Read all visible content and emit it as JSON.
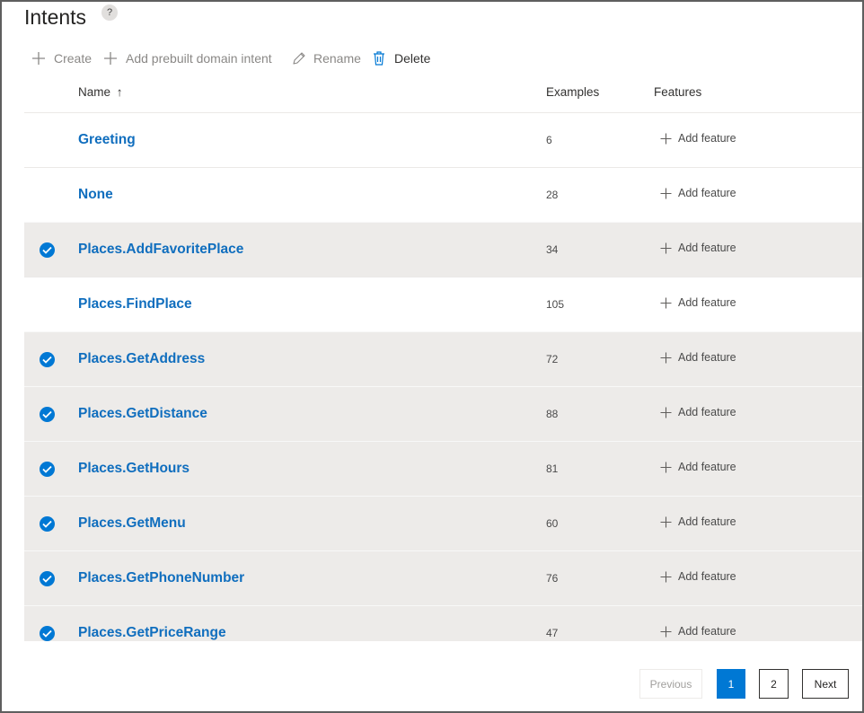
{
  "page": {
    "title": "Intents",
    "help_label": "?"
  },
  "toolbar": {
    "create": "Create",
    "add_prebuilt": "Add prebuilt domain intent",
    "rename": "Rename",
    "delete": "Delete"
  },
  "columns": {
    "name": "Name",
    "sort_indicator": "↑",
    "examples": "Examples",
    "features": "Features"
  },
  "rows": [
    {
      "name": "Greeting",
      "examples": "6",
      "feature": "Add feature",
      "selected": false
    },
    {
      "name": "None",
      "examples": "28",
      "feature": "Add feature",
      "selected": false
    },
    {
      "name": "Places.AddFavoritePlace",
      "examples": "34",
      "feature": "Add feature",
      "selected": true
    },
    {
      "name": "Places.FindPlace",
      "examples": "105",
      "feature": "Add feature",
      "selected": false
    },
    {
      "name": "Places.GetAddress",
      "examples": "72",
      "feature": "Add feature",
      "selected": true
    },
    {
      "name": "Places.GetDistance",
      "examples": "88",
      "feature": "Add feature",
      "selected": true
    },
    {
      "name": "Places.GetHours",
      "examples": "81",
      "feature": "Add feature",
      "selected": true
    },
    {
      "name": "Places.GetMenu",
      "examples": "60",
      "feature": "Add feature",
      "selected": true
    },
    {
      "name": "Places.GetPhoneNumber",
      "examples": "76",
      "feature": "Add feature",
      "selected": true
    },
    {
      "name": "Places.GetPriceRange",
      "examples": "47",
      "feature": "Add feature",
      "selected": true
    }
  ],
  "pagination": {
    "previous": "Previous",
    "pages": [
      "1",
      "2"
    ],
    "current_page": "1",
    "next": "Next"
  },
  "colors": {
    "accent": "#0078d4",
    "link": "#106ebe",
    "selected_row": "#edebe9"
  },
  "icons": {
    "create": "plus-icon",
    "add_prebuilt": "plus-icon",
    "rename": "pencil-icon",
    "delete": "trash-icon",
    "row_check": "check-circle-icon",
    "add_feature": "plus-icon"
  }
}
